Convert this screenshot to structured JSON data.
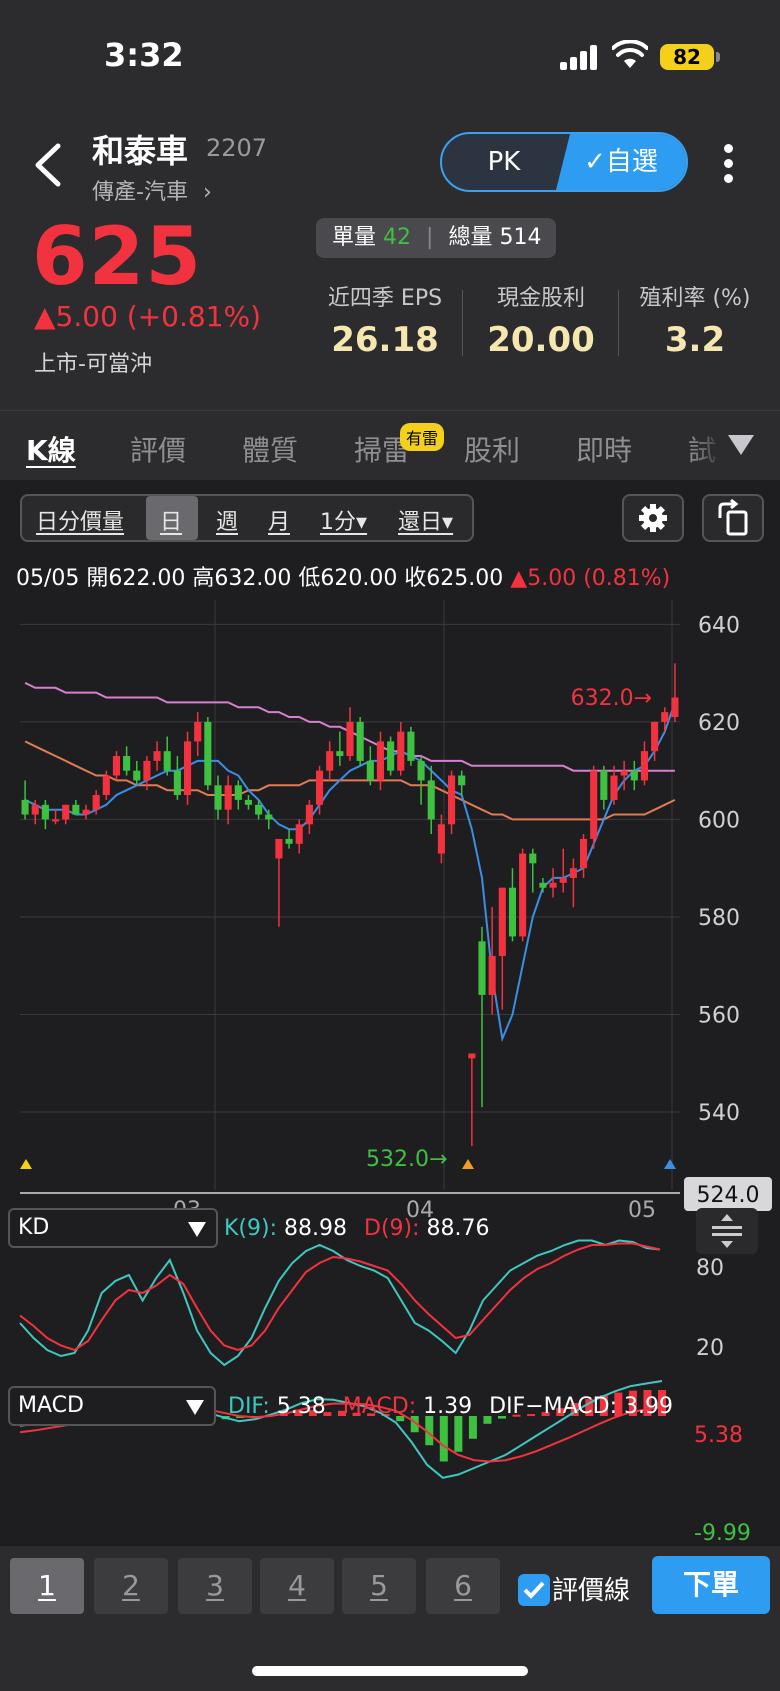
{
  "status_bar": {
    "time": "3:32",
    "battery": "82"
  },
  "header": {
    "name": "和泰車",
    "code": "2207",
    "industry": "傳產-汽車",
    "pk_label": "PK",
    "watchlist_label": "✓自選"
  },
  "quote": {
    "price": "625",
    "change": "▲5.00 (+0.81%)",
    "listing": "上市-可當沖",
    "single_volume_label": "單量",
    "single_volume": "42",
    "total_volume_label": "總量",
    "total_volume": "514"
  },
  "stats": [
    {
      "label": "近四季 EPS",
      "value": "26.18"
    },
    {
      "label": "現金股利",
      "value": "20.00"
    },
    {
      "label": "殖利率 (%)",
      "value": "3.2"
    }
  ],
  "tabs": [
    "K線",
    "評價",
    "體質",
    "掃雷",
    "股利",
    "即時",
    "試"
  ],
  "tab_badge": "有雷",
  "chart_toolbar": [
    "日分價量",
    "日",
    "週",
    "月",
    "1分▾",
    "還日▾"
  ],
  "ohlc_line": {
    "text": "05/05 開622.00 高632.00 低620.00 收625.00",
    "change": "▲5.00 (0.81%)"
  },
  "colors": {
    "up": "#f2333f",
    "down": "#3ec040",
    "accent": "#2e9cf0",
    "value_gold": "#f6e7b1"
  },
  "chart_data": [
    {
      "type": "candlestick",
      "y_ticks": [
        "640",
        "620",
        "600",
        "580",
        "560",
        "540"
      ],
      "x_ticks": [
        "03",
        "04",
        "05"
      ],
      "ylim": [
        524,
        645
      ],
      "high_marker": "632.0→",
      "low_marker": "532.0→",
      "last_label": "524.0",
      "candles": [
        [
          604,
          608,
          600,
          601
        ],
        [
          601,
          604,
          599,
          603
        ],
        [
          603,
          604,
          598,
          600
        ],
        [
          600,
          602,
          599,
          600
        ],
        [
          600,
          603,
          599,
          603
        ],
        [
          603,
          604,
          601,
          601
        ],
        [
          601,
          603,
          600,
          602
        ],
        [
          602,
          606,
          601,
          605
        ],
        [
          605,
          610,
          604,
          609
        ],
        [
          609,
          614,
          608,
          613
        ],
        [
          613,
          615,
          609,
          610
        ],
        [
          610,
          612,
          607,
          608
        ],
        [
          608,
          613,
          606,
          612
        ],
        [
          612,
          616,
          610,
          614
        ],
        [
          614,
          617,
          609,
          610
        ],
        [
          610,
          613,
          604,
          605
        ],
        [
          605,
          618,
          603,
          616
        ],
        [
          616,
          622,
          613,
          620
        ],
        [
          620,
          621,
          606,
          607
        ],
        [
          607,
          609,
          600,
          602
        ],
        [
          602,
          609,
          599,
          607
        ],
        [
          607,
          608,
          602,
          604
        ],
        [
          604,
          605,
          602,
          603
        ],
        [
          603,
          604,
          600,
          601
        ],
        [
          601,
          602,
          598,
          600
        ],
        [
          592,
          595,
          578,
          596
        ],
        [
          596,
          598,
          594,
          595
        ],
        [
          595,
          600,
          593,
          599
        ],
        [
          599,
          604,
          597,
          603
        ],
        [
          603,
          611,
          601,
          610
        ],
        [
          610,
          616,
          608,
          614
        ],
        [
          614,
          618,
          611,
          613
        ],
        [
          613,
          623,
          612,
          620
        ],
        [
          620,
          621,
          611,
          612
        ],
        [
          612,
          615,
          607,
          608
        ],
        [
          608,
          618,
          606,
          616
        ],
        [
          616,
          617,
          609,
          610
        ],
        [
          610,
          620,
          609,
          618
        ],
        [
          618,
          619,
          611,
          612
        ],
        [
          612,
          613,
          603,
          608
        ],
        [
          608,
          611,
          597,
          600
        ],
        [
          593,
          601,
          591,
          599
        ],
        [
          599,
          610,
          597,
          609
        ],
        [
          609,
          610,
          605,
          607
        ],
        [
          551,
          552,
          533,
          552
        ],
        [
          575,
          578,
          541,
          564
        ],
        [
          564,
          582,
          560,
          572
        ],
        [
          572,
          586,
          561,
          586
        ],
        [
          586,
          590,
          575,
          576
        ],
        [
          576,
          594,
          575,
          593
        ],
        [
          593,
          594,
          585,
          591
        ],
        [
          587,
          588,
          585,
          586
        ],
        [
          586,
          590,
          584,
          587
        ],
        [
          587,
          594,
          585,
          588
        ],
        [
          588,
          592,
          582,
          590
        ],
        [
          590,
          597,
          588,
          596
        ],
        [
          596,
          611,
          594,
          610
        ],
        [
          610,
          611,
          602,
          604
        ],
        [
          604,
          611,
          603,
          609
        ],
        [
          609,
          612,
          606,
          610
        ],
        [
          610,
          612,
          606,
          608
        ],
        [
          608,
          616,
          607,
          614
        ],
        [
          614,
          620,
          612,
          620
        ],
        [
          620,
          623,
          618,
          622
        ],
        [
          621,
          632,
          620,
          625
        ]
      ],
      "ma_short": [
        604,
        603,
        602,
        602,
        602,
        601,
        601,
        602,
        603,
        605,
        606,
        607,
        608,
        609,
        610,
        610,
        611,
        612,
        612,
        612,
        610,
        609,
        606,
        604,
        601,
        599,
        598,
        598,
        600,
        603,
        606,
        608,
        610,
        611,
        612,
        612,
        613,
        614,
        613,
        612,
        610,
        608,
        606,
        605,
        598,
        588,
        568,
        555,
        560,
        570,
        580,
        586,
        588,
        588,
        589,
        590,
        595,
        600,
        605,
        608,
        610,
        611,
        614,
        618,
        624
      ],
      "ma_mid": [
        616,
        615,
        614,
        613,
        612,
        611,
        610,
        609,
        609,
        608,
        608,
        607,
        607,
        607,
        606,
        606,
        606,
        606,
        605,
        605,
        605,
        605,
        606,
        606,
        607,
        607,
        607,
        607,
        608,
        608,
        608,
        608,
        608,
        608,
        608,
        608,
        608,
        608,
        607,
        607,
        607,
        606,
        605,
        604,
        603,
        602,
        601,
        601,
        600,
        600,
        600,
        600,
        600,
        600,
        600,
        600,
        600,
        600,
        601,
        601,
        601,
        601,
        602,
        603,
        604
      ],
      "ma_long": [
        628,
        627,
        627,
        627,
        626,
        626,
        626,
        626,
        625,
        625,
        625,
        625,
        625,
        625,
        624,
        624,
        624,
        624,
        624,
        624,
        624,
        623,
        623,
        623,
        622,
        622,
        621,
        621,
        620,
        620,
        619,
        619,
        618,
        617,
        616,
        615,
        614,
        614,
        613,
        613,
        612,
        612,
        612,
        612,
        611,
        611,
        611,
        611,
        611,
        611,
        611,
        611,
        611,
        611,
        610,
        610,
        610,
        610,
        610,
        610,
        610,
        610,
        610,
        610,
        610
      ]
    },
    {
      "type": "line",
      "name": "KD",
      "y_ticks": [
        "80",
        "20"
      ],
      "series": [
        {
          "name": "K(9)",
          "values": [
            40,
            30,
            22,
            18,
            20,
            35,
            60,
            68,
            72,
            55,
            70,
            82,
            60,
            35,
            20,
            12,
            18,
            30,
            50,
            68,
            80,
            88,
            92,
            88,
            82,
            78,
            75,
            70,
            55,
            40,
            35,
            28,
            20,
            35,
            55,
            65,
            75,
            80,
            85,
            88,
            92,
            95,
            95,
            92,
            95,
            94,
            90,
            89
          ]
        },
        {
          "name": "D(9)",
          "values": [
            45,
            38,
            30,
            25,
            22,
            28,
            42,
            55,
            62,
            60,
            65,
            72,
            66,
            50,
            35,
            25,
            22,
            25,
            35,
            50,
            62,
            74,
            80,
            84,
            83,
            81,
            78,
            75,
            66,
            55,
            46,
            38,
            30,
            32,
            42,
            52,
            62,
            70,
            76,
            80,
            85,
            89,
            92,
            92,
            93,
            93,
            91,
            89
          ]
        }
      ],
      "K_value": "88.98",
      "D_value": "88.76"
    },
    {
      "type": "bar",
      "name": "MACD",
      "y_ticks": [
        "5.38",
        "-9.99"
      ],
      "histogram": [
        0.6,
        0.5,
        0.5,
        0.4,
        0.3,
        0.2,
        0.2,
        0.5,
        0.8,
        1.0,
        0.8,
        0.4,
        0.1,
        -0.3,
        -0.5,
        -0.3,
        -0.2,
        0.2,
        0.8,
        1.0,
        0.9,
        0.6,
        0.8,
        0.5,
        0.4,
        0.3,
        -0.8,
        -2.5,
        -4.5,
        -7.0,
        -5.5,
        -3.5,
        -1.2,
        -0.4,
        0.2,
        0.3,
        0.6,
        1.2,
        2.0,
        2.6,
        3.2,
        3.6,
        3.9,
        4.0,
        3.99
      ],
      "dif": [
        -1.5,
        -1.2,
        -0.8,
        -0.4,
        0.0,
        0.4,
        0.8,
        1.2,
        1.6,
        1.8,
        1.5,
        1.0,
        0.5,
        -0.2,
        -0.8,
        -0.5,
        0.2,
        1.0,
        2.0,
        2.6,
        2.5,
        2.0,
        1.5,
        0.5,
        -1.0,
        -4.0,
        -7.5,
        -9.5,
        -9.0,
        -8.0,
        -7.0,
        -6.0,
        -4.5,
        -3.0,
        -1.5,
        0.0,
        1.5,
        2.8,
        3.8,
        4.6,
        5.0,
        5.38
      ],
      "macd_line": [
        -2.5,
        -2.2,
        -1.8,
        -1.4,
        -1.0,
        -0.5,
        0.0,
        0.5,
        1.0,
        1.3,
        1.4,
        1.3,
        1.0,
        0.5,
        0.0,
        -0.2,
        0.0,
        0.4,
        1.0,
        1.6,
        1.9,
        1.9,
        1.8,
        1.4,
        0.8,
        -0.6,
        -2.4,
        -4.5,
        -6.0,
        -6.8,
        -7.0,
        -6.8,
        -6.2,
        -5.4,
        -4.4,
        -3.4,
        -2.3,
        -1.2,
        -0.2,
        0.6,
        1.0,
        1.39
      ],
      "DIF_value": "5.38",
      "MACD_value": "1.39",
      "DIF_MACD_value": "3.99"
    }
  ],
  "kd_panel": {
    "select_label": "KD",
    "k_label": "K(9):",
    "d_label": "D(9):"
  },
  "macd_panel": {
    "select_label": "MACD",
    "dif_label": "DIF:",
    "macd_label": "MACD:",
    "diff_label": "DIF−MACD:"
  },
  "bottom_bar": {
    "pages": [
      "1",
      "2",
      "3",
      "4",
      "5",
      "6"
    ],
    "checkbox_label": "評價線",
    "order_label": "下單"
  }
}
